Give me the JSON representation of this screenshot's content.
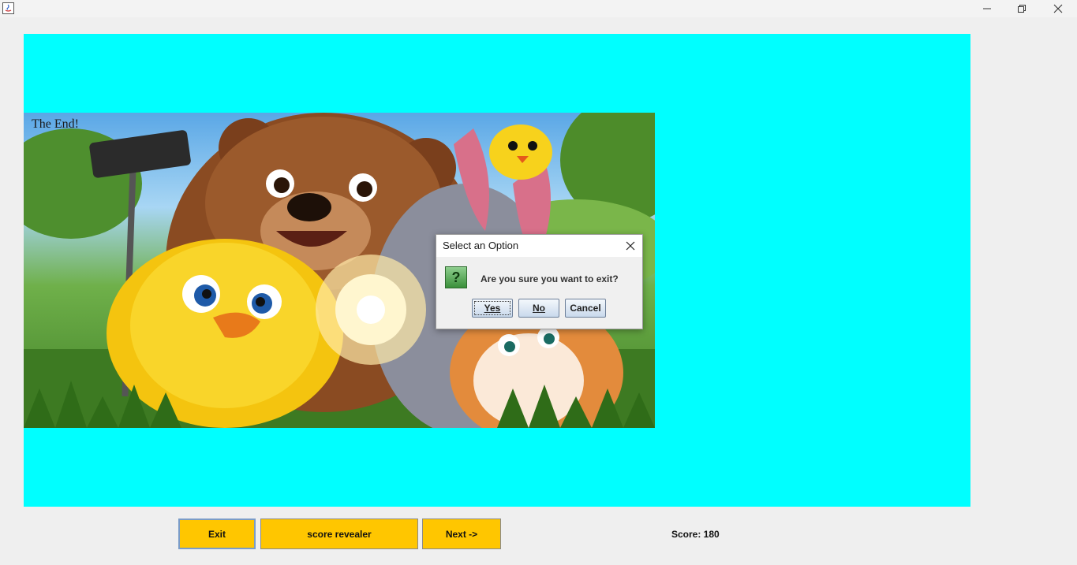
{
  "window": {
    "minimize_icon": "minimize-icon",
    "maximize_icon": "restore-icon",
    "close_icon": "close-icon"
  },
  "game": {
    "panel_color": "#00ffff",
    "scene_caption": "The End!"
  },
  "dialog": {
    "title": "Select an Option",
    "message": "Are you sure you want to exit?",
    "yes_label": "Yes",
    "no_label": "No",
    "cancel_label": "Cancel",
    "icon": "question-icon"
  },
  "controls": {
    "exit_label": "Exit",
    "score_revealer_label": "score revealer",
    "next_label": "Next ->",
    "button_color": "#ffc600"
  },
  "status": {
    "score_text": "Score: 180"
  }
}
